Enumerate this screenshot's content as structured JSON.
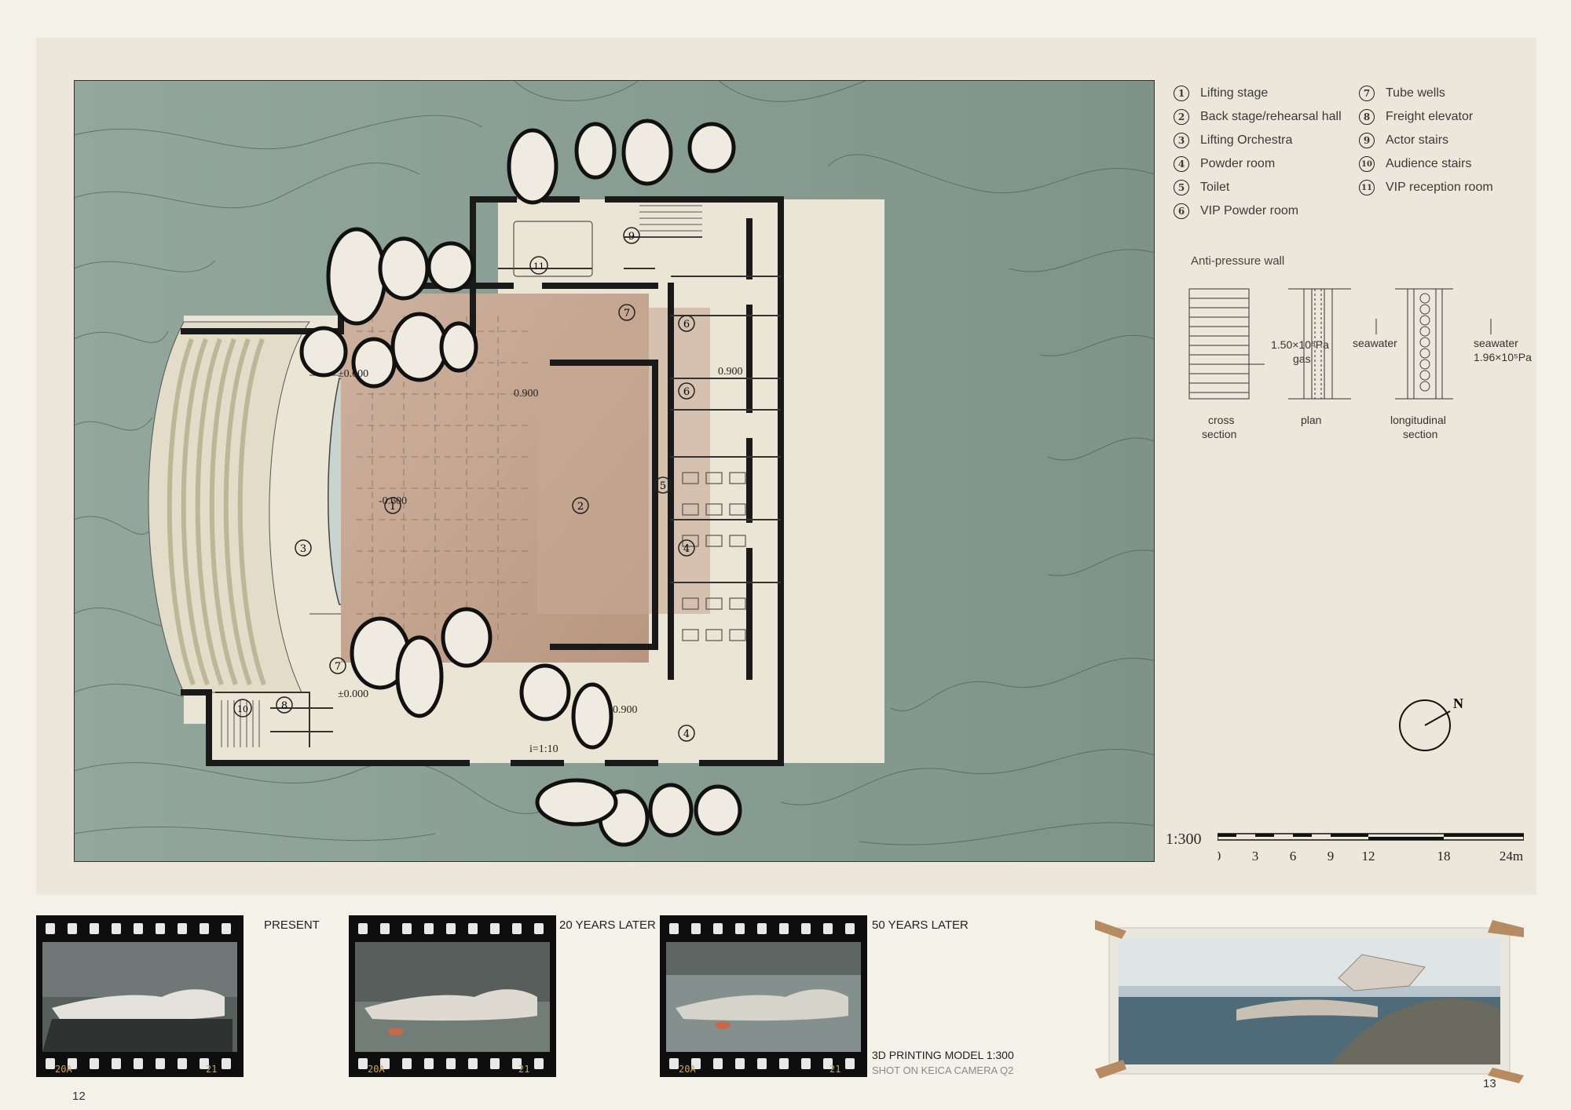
{
  "legend_left": [
    {
      "num": "1",
      "label": "Lifting stage"
    },
    {
      "num": "2",
      "label": "Back stage/rehearsal hall"
    },
    {
      "num": "3",
      "label": "Lifting Orchestra"
    },
    {
      "num": "4",
      "label": "Powder room"
    },
    {
      "num": "5",
      "label": "Toilet"
    },
    {
      "num": "6",
      "label": "VIP Powder room"
    }
  ],
  "legend_right": [
    {
      "num": "7",
      "label": "Tube wells"
    },
    {
      "num": "8",
      "label": "Freight elevator"
    },
    {
      "num": "9",
      "label": "Actor stairs"
    },
    {
      "num": "10",
      "label": "Audience stairs"
    },
    {
      "num": "11",
      "label": "VIP reception room"
    }
  ],
  "anti_pressure": {
    "title": "Anti-pressure wall",
    "gas_pressure": "1.50×10⁵Pa",
    "gas": "gas",
    "seawater_plan": "seawater",
    "seawater_long": "seawater",
    "sea_pressure": "1.96×10⁵Pa",
    "cross": "cross",
    "cross2": "section",
    "plan": "plan",
    "long": "longitudinal",
    "long2": "section"
  },
  "plan_labels": {
    "lvl_pm0_top": "±0.000",
    "lvl_pm0_bottom": "±0.000",
    "lvl_minus": "-0.600",
    "lvl_090_a": "0.900",
    "lvl_090_b": "0.900",
    "lvl_090_c": "0.900",
    "slope": "i=1:10",
    "room1": "1",
    "room2": "2",
    "room3": "3",
    "room4a": "4",
    "room4b": "4",
    "room5": "5",
    "room6a": "6",
    "room6b": "6",
    "room7a": "7",
    "room7b": "7",
    "room8": "8",
    "room9": "9",
    "room10": "10",
    "room11": "11"
  },
  "scale": {
    "label": "1:300",
    "ticks": [
      "0",
      "3",
      "6",
      "9",
      "12",
      "18",
      "24m"
    ]
  },
  "compass_label": "N",
  "films": [
    {
      "label": "PRESENT",
      "code": "20A",
      "frame": "21"
    },
    {
      "label": "20 YEARS LATER",
      "code": "20A",
      "frame": "21"
    },
    {
      "label": "50 YEARS LATER",
      "code": "20A",
      "frame": "21"
    }
  ],
  "model_caption": "3D PRINTING MODEL  1:300",
  "model_sub": "SHOT ON KEICA CAMERA  Q2",
  "page_left": "12",
  "page_right": "13",
  "colors": {
    "sea": "#8ea399",
    "paper": "#ece7da",
    "wood": "#c9ab97",
    "wall": "#1a1a1a"
  }
}
